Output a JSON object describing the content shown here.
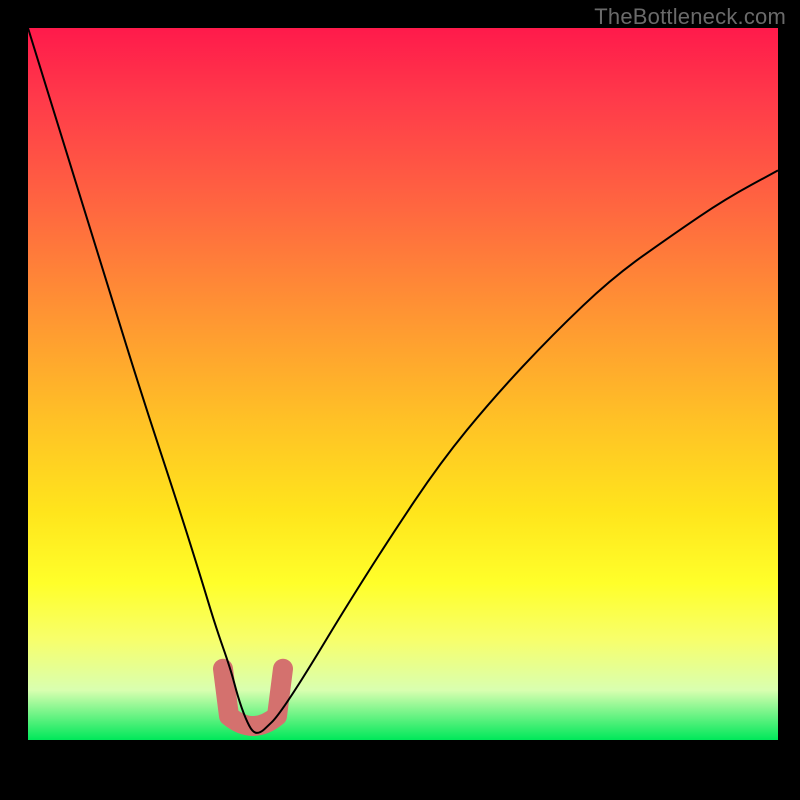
{
  "watermark": "TheBottleneck.com",
  "chart_data": {
    "type": "line",
    "title": "",
    "xlabel": "",
    "ylabel": "",
    "xlim": [
      0,
      100
    ],
    "ylim": [
      0,
      100
    ],
    "grid": false,
    "legend": false,
    "series": [
      {
        "name": "bottleneck-curve",
        "x": [
          0,
          5,
          10,
          15,
          20,
          23,
          25,
          27,
          28,
          29,
          30,
          31,
          32,
          33,
          35,
          38,
          42,
          48,
          55,
          62,
          70,
          78,
          86,
          93,
          100
        ],
        "values": [
          100,
          83,
          66,
          49,
          33,
          23,
          16,
          10,
          6,
          3,
          1,
          1,
          2,
          3,
          6,
          11,
          18,
          28,
          39,
          48,
          57,
          65,
          71,
          76,
          80
        ]
      }
    ],
    "annotations": [
      {
        "name": "optimum-dip",
        "x_range": [
          26,
          34
        ],
        "y_range": [
          0,
          10
        ],
        "color": "#d4716e"
      }
    ]
  },
  "colors": {
    "gradient_top": "#ff1a4b",
    "gradient_bottom": "#00e85a",
    "curve": "#000000",
    "marker": "#d4716e",
    "watermark": "#6a6a6a"
  }
}
